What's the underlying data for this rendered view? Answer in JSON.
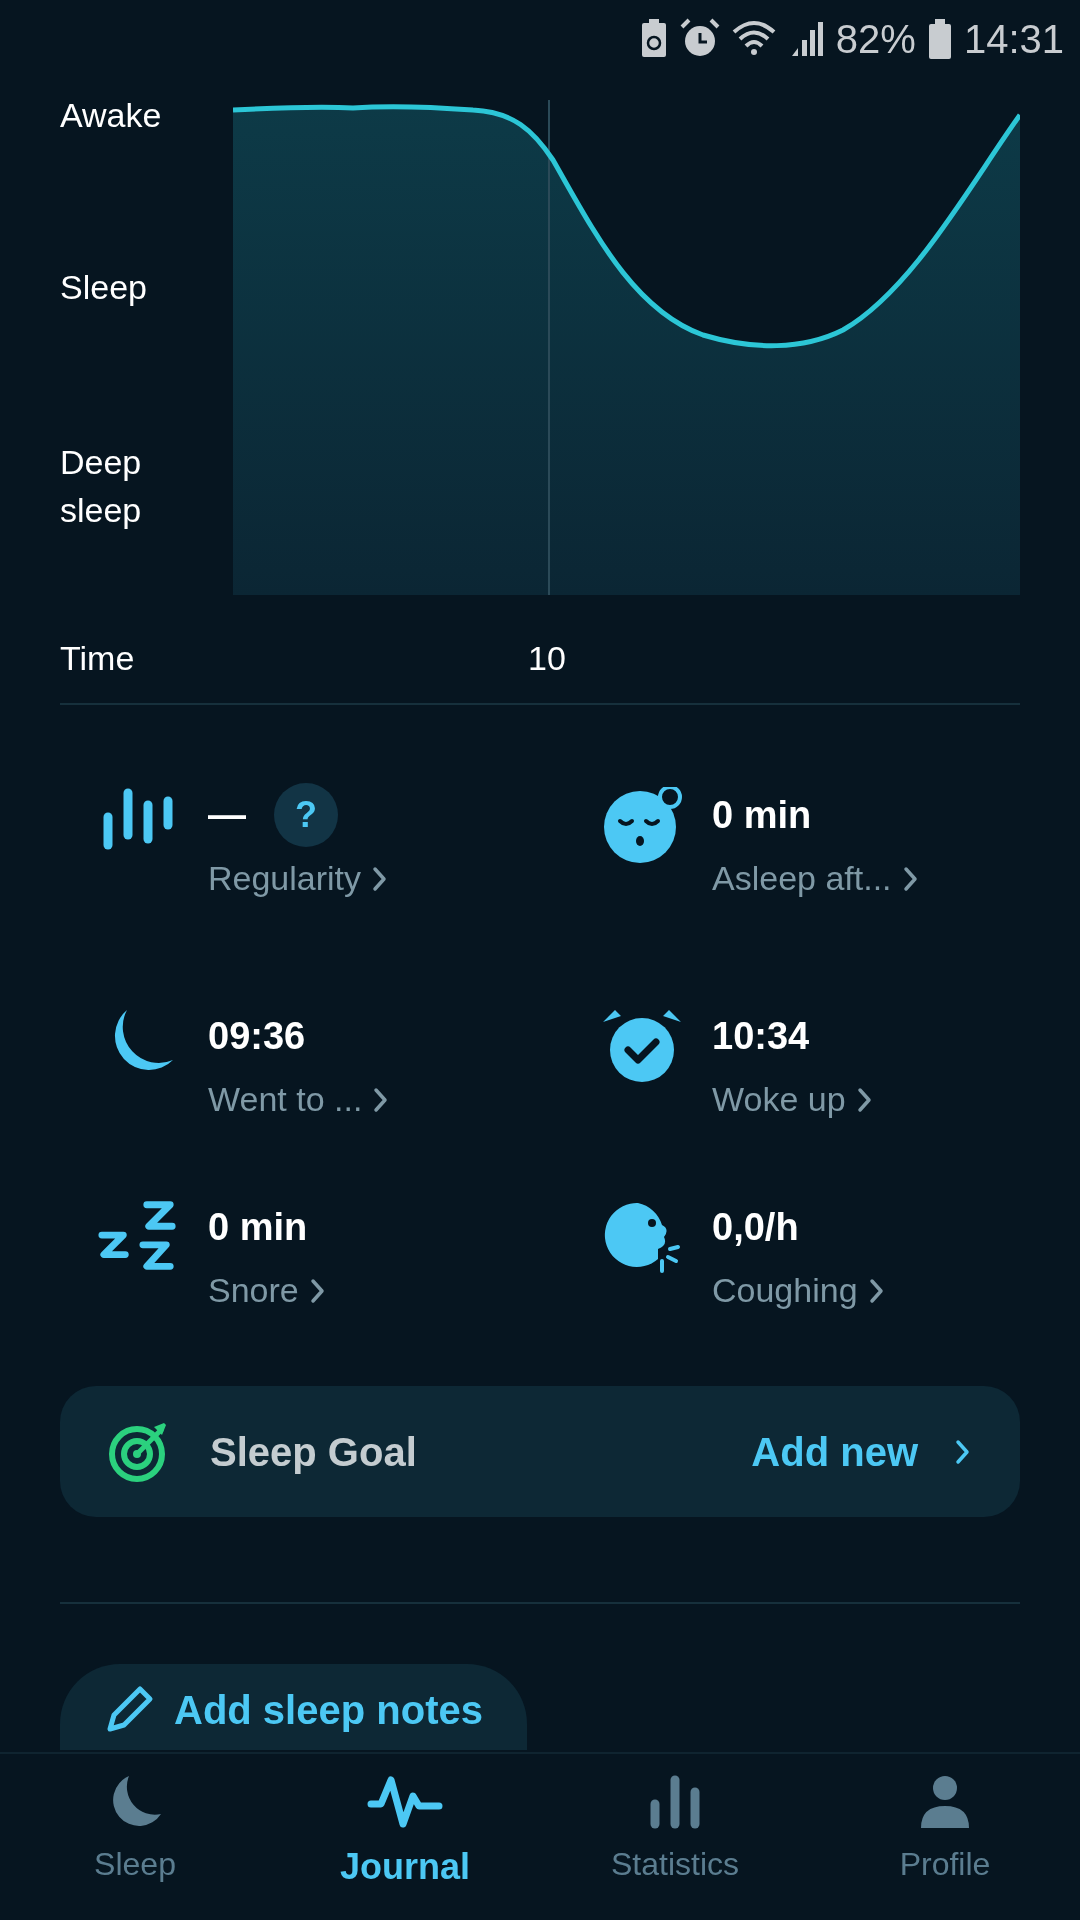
{
  "status_bar": {
    "battery": "82%",
    "time": "14:31"
  },
  "chart": {
    "y_labels": [
      "Awake",
      "Sleep",
      "Deep sleep"
    ],
    "x_label": "Time",
    "x_ticks": [
      "10"
    ]
  },
  "stats": [
    {
      "value": "—",
      "label": "Regularity",
      "help": "?"
    },
    {
      "value": "0 min",
      "label": "Asleep aft..."
    },
    {
      "value": "09:36",
      "label": "Went to ..."
    },
    {
      "value": "10:34",
      "label": "Woke up"
    },
    {
      "value": "0 min",
      "label": "Snore"
    },
    {
      "value": "0,0/h",
      "label": "Coughing"
    }
  ],
  "sleep_goal": {
    "title": "Sleep Goal",
    "action": "Add new"
  },
  "notes_button": "Add sleep notes",
  "nav": [
    {
      "label": "Sleep",
      "selected": false
    },
    {
      "label": "Journal",
      "selected": true
    },
    {
      "label": "Statistics",
      "selected": false
    },
    {
      "label": "Profile",
      "selected": false
    }
  ]
}
